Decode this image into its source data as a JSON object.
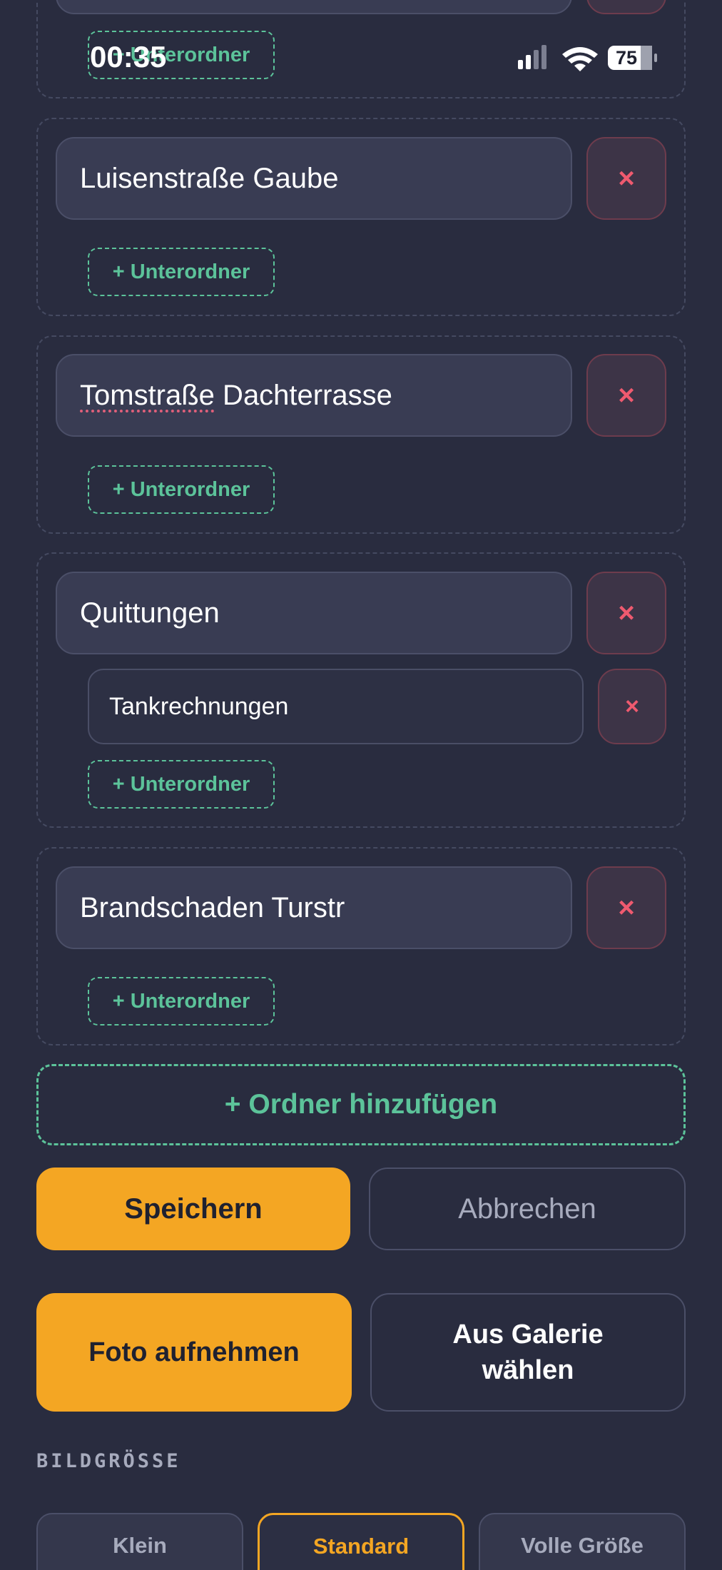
{
  "status_bar": {
    "time": "00:35",
    "battery": "75",
    "icons": [
      "cellular-signal-icon",
      "wifi-icon",
      "battery-icon"
    ]
  },
  "folders": [
    {
      "name": "",
      "add_sub_label": "+ Unterordner"
    },
    {
      "name": "Luisenstraße Gaube",
      "add_sub_label": "+ Unterordner"
    },
    {
      "name_part1": "Tomstraße",
      "name_part2": " Dachterrasse",
      "add_sub_label": "+ Unterordner"
    },
    {
      "name": "Quittungen",
      "subfolders": [
        {
          "name": "Tankrechnungen"
        }
      ],
      "add_sub_label": "+ Unterordner"
    },
    {
      "name": "Brandschaden Turstr",
      "add_sub_label": "+ Unterordner"
    }
  ],
  "delete_symbol": "×",
  "add_folder_label": "+ Ordner hinzufügen",
  "actions": {
    "save": "Speichern",
    "cancel": "Abbrechen"
  },
  "photo": {
    "take": "Foto aufnehmen",
    "gallery_line1": "Aus Galerie",
    "gallery_line2": "wählen"
  },
  "image_size": {
    "label": "BILDGRÖSSE",
    "options": [
      "Klein",
      "Standard",
      "Volle Größe"
    ],
    "selected": "Standard"
  },
  "colors": {
    "background": "#292c3f",
    "accent_green": "#5cc39a",
    "accent_orange": "#f4a623",
    "delete_red": "#ef5a6f"
  }
}
